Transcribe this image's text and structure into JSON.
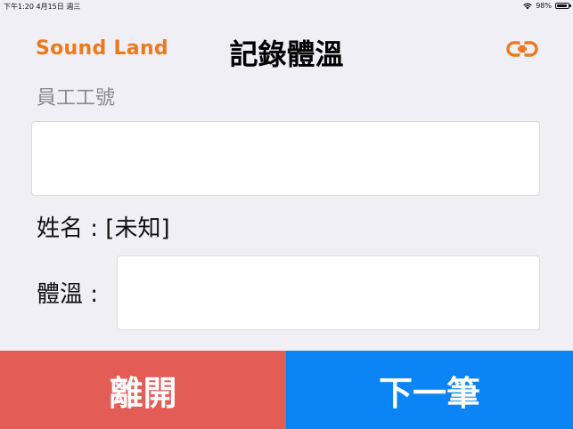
{
  "status_bar": {
    "time_date": "下午1:20   4月15日 週三",
    "battery": "98%",
    "wifi_icon": "wifi-icon",
    "battery_icon": "battery-icon"
  },
  "header": {
    "brand": "Sound Land",
    "title": "記錄體溫",
    "link_icon": "link-icon",
    "accent_color": "#ec7a1c"
  },
  "form": {
    "employee_label": "員工工號",
    "employee_value": "",
    "name_prefix": "姓名 : ",
    "name_value": "[未知]",
    "temp_label": "體溫 :",
    "temp_value": ""
  },
  "actions": {
    "leave_label": "離開",
    "next_label": "下一筆",
    "leave_color": "#e35d56",
    "next_color": "#0b84f5"
  }
}
